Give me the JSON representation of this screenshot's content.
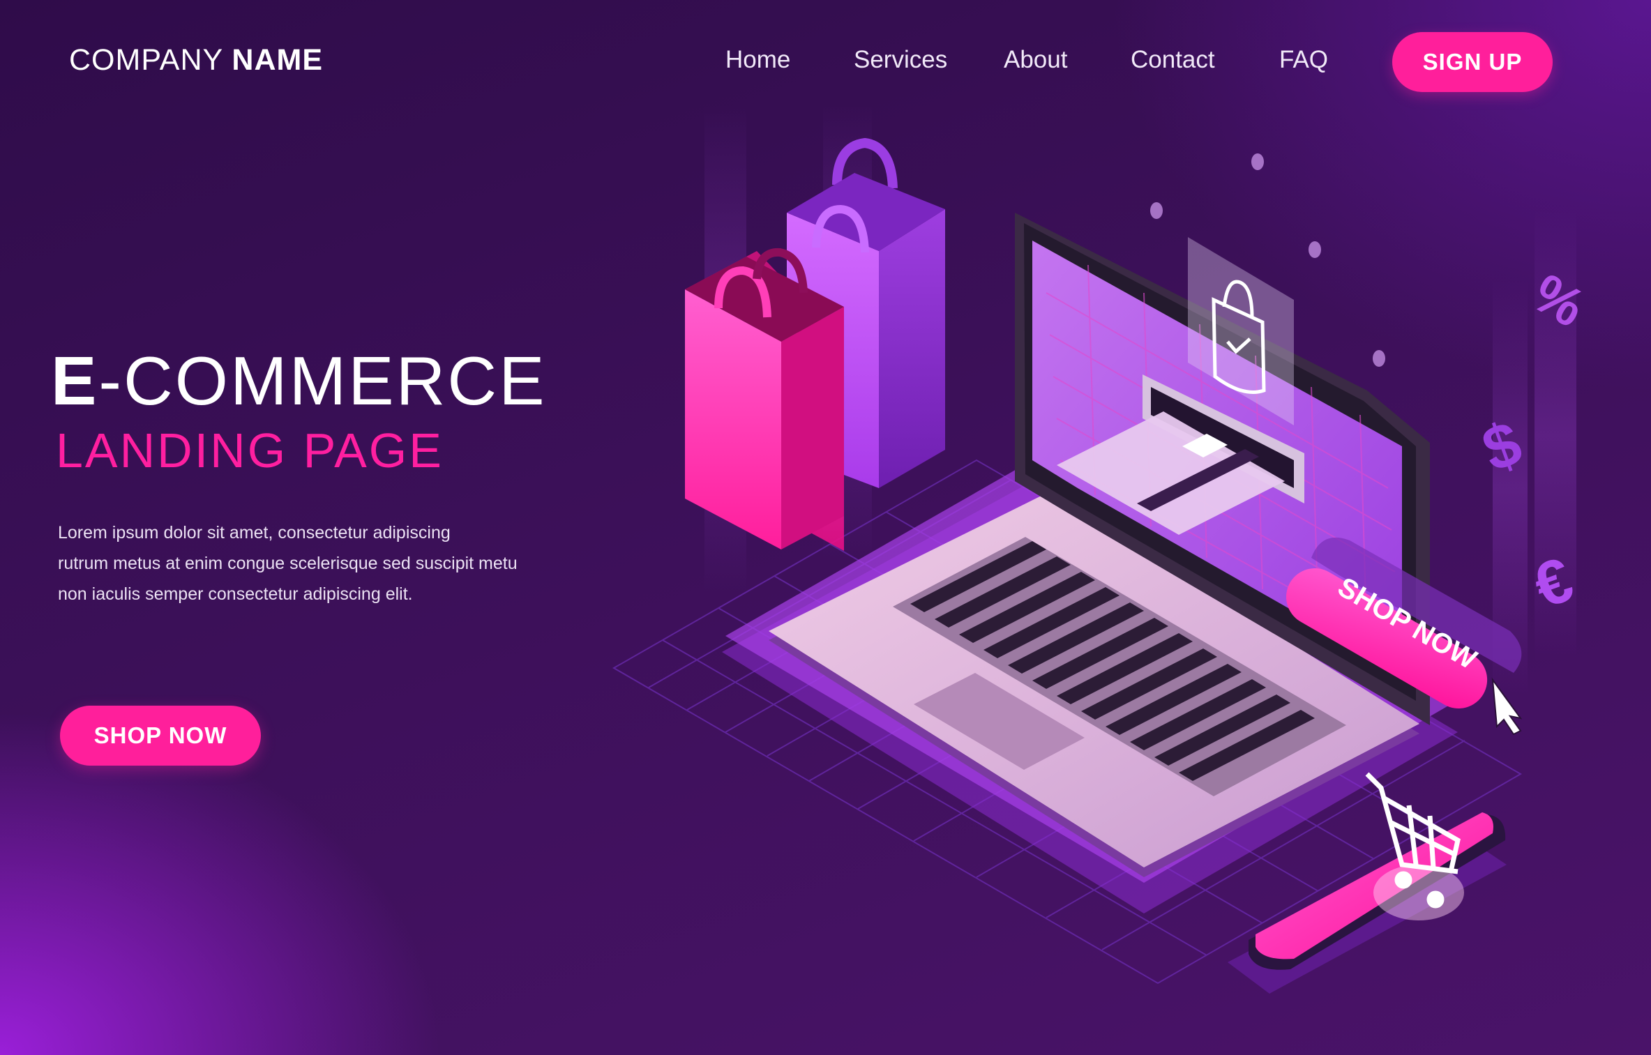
{
  "header": {
    "brand_regular": "COMPANY ",
    "brand_bold": "NAME",
    "nav": [
      {
        "label": "Home"
      },
      {
        "label": "Services"
      },
      {
        "label": "About"
      },
      {
        "label": "Contact"
      },
      {
        "label": "FAQ"
      }
    ],
    "signup_label": "SIGN UP"
  },
  "hero": {
    "title_first_letter": "E",
    "title_rest": "-COMMERCE",
    "subtitle": "LANDING PAGE",
    "body_lines": [
      "Lorem ipsum dolor sit amet, consectetur adipiscing",
      "rutrum metus at enim congue scelerisque sed suscipit metu",
      "non iaculis semper consectetur adipiscing elit."
    ],
    "cta_label": "SHOP NOW"
  },
  "illustration": {
    "screen_button_label": "SHOP NOW",
    "currency_symbols": [
      "%",
      "$",
      "€"
    ],
    "icons": [
      "shopping-bag-icon",
      "credit-card-icon",
      "shopping-cart-icon",
      "cursor-icon",
      "check-icon"
    ]
  },
  "colors": {
    "accent": "#ff1f9b",
    "background_dark": "#2f0c4a",
    "background_light": "#9a1fd8",
    "violet": "#b346f0"
  }
}
